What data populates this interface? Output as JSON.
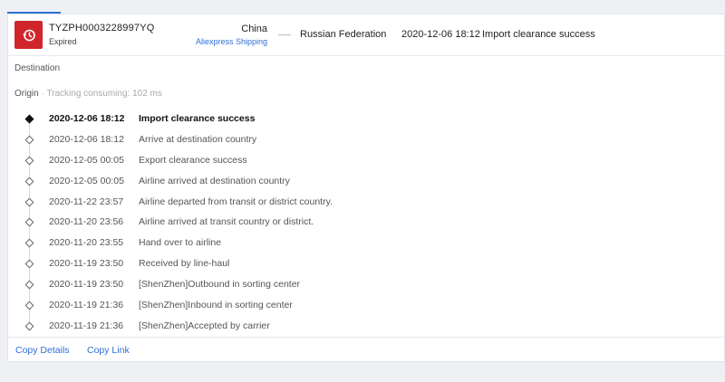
{
  "header": {
    "tracking_number": "TYZPH0003228997YQ",
    "status": "Expired",
    "origin_country": "China",
    "carrier": "Aliexpress Shipping",
    "destination_country": "Russian Federation",
    "latest_time": "2020-12-06 18:12",
    "latest_status": "Import clearance success",
    "status_icon": "history-clock-icon",
    "status_color": "#d0262b",
    "accent_color": "#2f6fd6"
  },
  "sections": {
    "destination_label": "Destination",
    "origin_label": "Origin",
    "tracking_consuming": "Tracking consuming: 102 ms"
  },
  "events": [
    {
      "time": "2020-12-06 18:12",
      "desc": "Import clearance success"
    },
    {
      "time": "2020-12-06 18:12",
      "desc": "Arrive at destination country"
    },
    {
      "time": "2020-12-05 00:05",
      "desc": "Export clearance success"
    },
    {
      "time": "2020-12-05 00:05",
      "desc": "Airline arrived at destination country"
    },
    {
      "time": "2020-11-22 23:57",
      "desc": "Airline departed from transit or district country."
    },
    {
      "time": "2020-11-20 23:56",
      "desc": "Airline arrived at transit country or district."
    },
    {
      "time": "2020-11-20 23:55",
      "desc": "Hand over to airline"
    },
    {
      "time": "2020-11-19 23:50",
      "desc": "Received by line-haul"
    },
    {
      "time": "2020-11-19 23:50",
      "desc": "[ShenZhen]Outbound in sorting center"
    },
    {
      "time": "2020-11-19 21:36",
      "desc": "[ShenZhen]Inbound in sorting center"
    },
    {
      "time": "2020-11-19 21:36",
      "desc": "[ShenZhen]Accepted by carrier"
    }
  ],
  "footer": {
    "copy_details": "Copy Details",
    "copy_link": "Copy Link"
  }
}
